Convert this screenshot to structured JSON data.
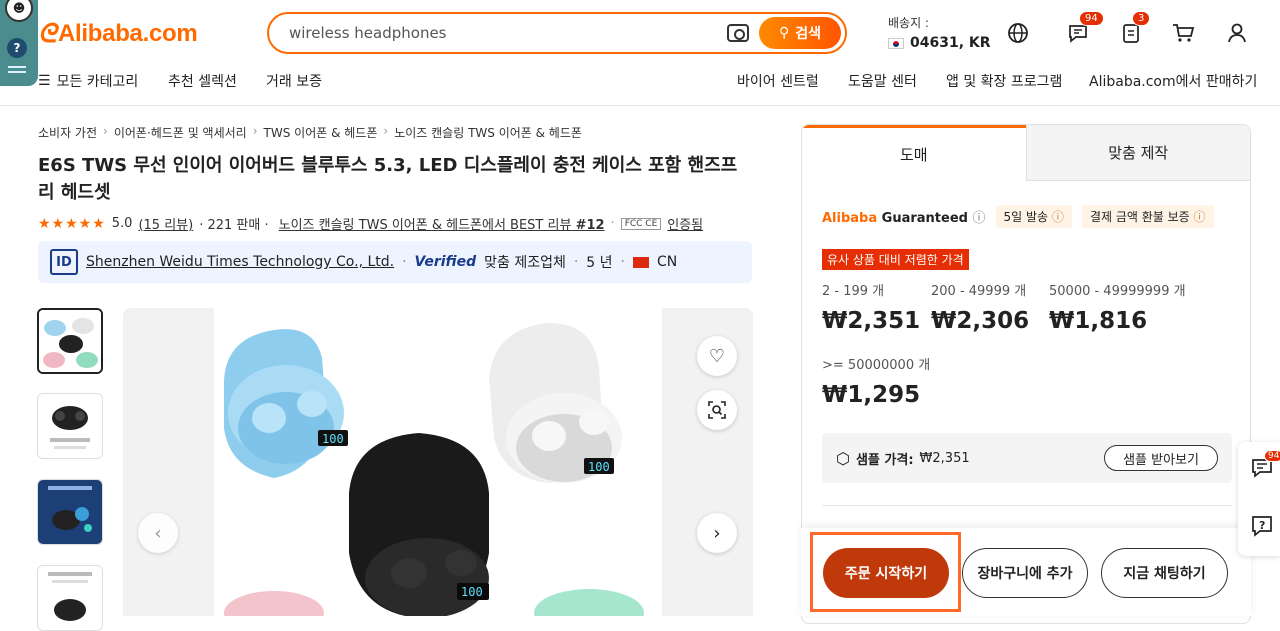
{
  "header": {
    "logo_text": "Alibaba.com",
    "search_placeholder": "wireless headphones",
    "search_button": "검색",
    "ship_label": "배송지 :",
    "ship_location": "04631, KR",
    "messages_count": "94",
    "orders_count": "3",
    "nav_left": [
      "모든 카테고리",
      "추천 셀렉션",
      "거래 보증"
    ],
    "nav_right": [
      "바이어 센트럴",
      "도움말 센터",
      "앱 및 확장 프로그램",
      "Alibaba.com에서 판매하기"
    ]
  },
  "breadcrumb": [
    "소비자 가전",
    "이어폰·헤드폰 및 액세서리",
    "TWS 이어폰 & 헤드폰",
    "노이즈 캔슬링 TWS 이어폰 & 헤드폰"
  ],
  "product": {
    "title": "E6S TWS 무선 인이어 이어버드 블루투스 5.3, LED 디스플레이 충전 케이스 포함 핸즈프리 헤드셋",
    "rating": "5.0",
    "reviews": "15 리뷰",
    "sold": "· 221 판매 ·",
    "best_review": "노이즈 캔슬링 TWS 이어폰 & 헤드폰에서 BEST 리뷰",
    "best_rank": "#12",
    "cert_badges": "FCC CE",
    "certified": "인증됨"
  },
  "supplier": {
    "name": "Shenzhen Weidu Times Technology Co., Ltd.",
    "verified": "Verified",
    "type": "맞춤 제조업체",
    "years": "5 년",
    "country": "CN"
  },
  "panel": {
    "tab_wholesale": "도매",
    "tab_custom": "맞춤 제작",
    "guaranteed_a": "Alibaba",
    "guaranteed_b": " Guaranteed",
    "ship_days": "5일 발송",
    "refund": "결제 금액 환불 보증",
    "deal_label": "유사 상품 대비 저렴한 가격",
    "tiers": [
      {
        "qty": "2 - 199 개",
        "price": "₩2,351"
      },
      {
        "qty": "200 - 49999 개",
        "price": "₩2,306"
      },
      {
        "qty": "50000 - 49999999 개",
        "price": "₩1,816"
      },
      {
        "qty": ">= 50000000 개",
        "price": "₩1,295"
      }
    ],
    "sample_label": "샘플 가격:",
    "sample_price": "₩2,351",
    "sample_button": "샘플 받아보기"
  },
  "actions": {
    "start_order": "주문 시작하기",
    "add_to_cart": "장바구니에 추가",
    "chat_now": "지금 채팅하기"
  },
  "floating": {
    "msg_count": "94"
  }
}
